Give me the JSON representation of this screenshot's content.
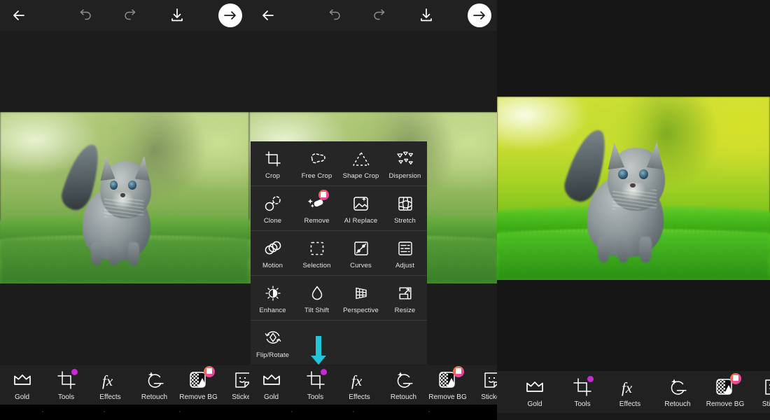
{
  "app": {
    "theme_bg": "#1c1c1c",
    "bar_bg": "#212121",
    "accent_dot": "#c928d6",
    "pro_badge_gradient": "#ef4d8d",
    "arrow_hint_color": "#22c5d8"
  },
  "topbar": {
    "back_label": "Back",
    "undo_label": "Undo",
    "redo_label": "Redo",
    "save_label": "Save",
    "next_label": "Next"
  },
  "tools_menu": {
    "visible_in_panel": 2,
    "rows": [
      [
        {
          "label": "Crop",
          "icon": "crop-icon",
          "badge": false
        },
        {
          "label": "Free Crop",
          "icon": "free-crop-icon",
          "badge": false
        },
        {
          "label": "Shape Crop",
          "icon": "shape-crop-icon",
          "badge": false
        },
        {
          "label": "Dispersion",
          "icon": "dispersion-icon",
          "badge": false
        }
      ],
      [
        {
          "label": "Clone",
          "icon": "clone-icon",
          "badge": false
        },
        {
          "label": "Remove",
          "icon": "remove-icon",
          "badge": true
        },
        {
          "label": "AI Replace",
          "icon": "ai-replace-icon",
          "badge": false
        },
        {
          "label": "Stretch",
          "icon": "stretch-icon",
          "badge": false
        }
      ],
      [
        {
          "label": "Motion",
          "icon": "motion-icon",
          "badge": false
        },
        {
          "label": "Selection",
          "icon": "selection-icon",
          "badge": false
        },
        {
          "label": "Curves",
          "icon": "curves-icon",
          "badge": false
        },
        {
          "label": "Adjust",
          "icon": "adjust-icon",
          "badge": false
        }
      ],
      [
        {
          "label": "Enhance",
          "icon": "enhance-icon",
          "badge": false
        },
        {
          "label": "Tilt Shift",
          "icon": "tilt-shift-icon",
          "badge": false
        },
        {
          "label": "Perspective",
          "icon": "perspective-icon",
          "badge": false
        },
        {
          "label": "Resize",
          "icon": "resize-icon",
          "badge": false
        }
      ],
      [
        {
          "label": "Flip/Rotate",
          "icon": "flip-rotate-icon",
          "badge": false
        }
      ]
    ]
  },
  "bottom_nav": {
    "items": [
      {
        "label": "Gold",
        "icon": "crown-icon",
        "dot": false,
        "badge": false
      },
      {
        "label": "Tools",
        "icon": "crop-tools-icon",
        "dot": true,
        "badge": false
      },
      {
        "label": "Effects",
        "icon": "fx-icon",
        "dot": false,
        "badge": false
      },
      {
        "label": "Retouch",
        "icon": "retouch-face-icon",
        "dot": false,
        "badge": false
      },
      {
        "label": "Remove BG",
        "icon": "remove-bg-icon",
        "dot": false,
        "badge": true
      },
      {
        "label": "Sticker",
        "icon": "sticker-icon",
        "dot": false,
        "badge": false
      }
    ]
  },
  "panels": [
    {
      "name": "panel-left",
      "image_alt": "grey tabby kitten walking in green grass"
    },
    {
      "name": "panel-center",
      "image_alt": "grey tabby kitten walking in green grass",
      "menu_open": true
    },
    {
      "name": "panel-right",
      "image_alt": "grey tabby kitten in vivid enhanced green grass",
      "enhanced": true
    }
  ]
}
